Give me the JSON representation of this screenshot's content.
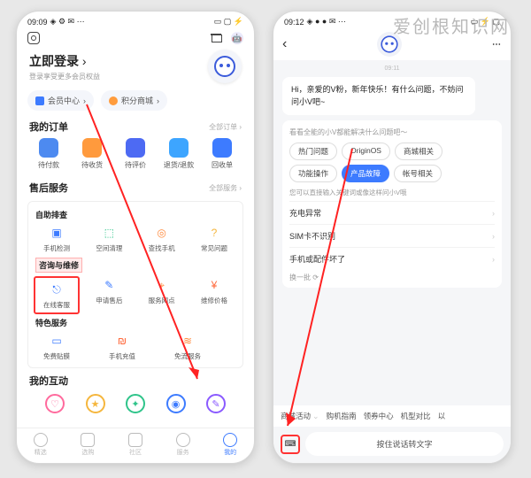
{
  "watermark": "爱创根知识网",
  "left": {
    "status": {
      "time": "09:09",
      "icons": "◈ ⚙ ✉ ⋯",
      "right": "▭ ▢ ⚡"
    },
    "settings_icon": "settings",
    "cart_icon": "cart",
    "chat_icon": "chat",
    "login": {
      "title": "立即登录",
      "sub": "登录享受更多会员权益"
    },
    "pills": {
      "member": "会员中心",
      "points": "积分商城"
    },
    "orders": {
      "title": "我的订单",
      "link": "全部订单 ›",
      "items": [
        {
          "label": "待付款"
        },
        {
          "label": "待收货"
        },
        {
          "label": "待评价"
        },
        {
          "label": "退货/退款"
        },
        {
          "label": "回收单"
        }
      ]
    },
    "aftersale": {
      "title": "售后服务",
      "link": "全部服务 ›",
      "self": {
        "sub": "自助排查",
        "items": [
          "手机检测",
          "空间清理",
          "查找手机",
          "常见问题"
        ]
      },
      "consult": {
        "sub": "咨询与维修",
        "items": [
          "在线客服",
          "申请售后",
          "服务网点",
          "维修价格"
        ]
      },
      "special": {
        "sub": "特色服务",
        "items": [
          "免费贴膜",
          "手机充值",
          "免流服务"
        ]
      }
    },
    "interact": {
      "title": "我的互动"
    },
    "tabs": [
      "精选",
      "选购",
      "社区",
      "服务",
      "我的"
    ]
  },
  "right": {
    "status": {
      "time": "09:12",
      "icons": "◈ ● ● ✉ ⋯",
      "right": "▭ ⚡ ▢"
    },
    "ts": "09:11",
    "greeting": "Hi，亲爱的V粉，新年快乐！有什么问题，不妨问问小V吧~",
    "card1": {
      "title": "看看全能的小V都能解决什么问题吧～",
      "chips": [
        "热门问题",
        "OriginOS",
        "商城相关",
        "功能操作",
        "产品故障",
        "帐号相关"
      ],
      "active": 4,
      "sub": "您可以直接输入关键词或像这样问小V哦",
      "questions": [
        "充电异常",
        "SIM卡不识别",
        "手机或配件坏了"
      ],
      "refresh": "换一批 ⟳"
    },
    "bottom_chips": [
      "商城活动",
      "购机指南",
      "领券中心",
      "机型对比",
      "以"
    ],
    "input": {
      "placeholder": "按住说话转文字"
    }
  }
}
